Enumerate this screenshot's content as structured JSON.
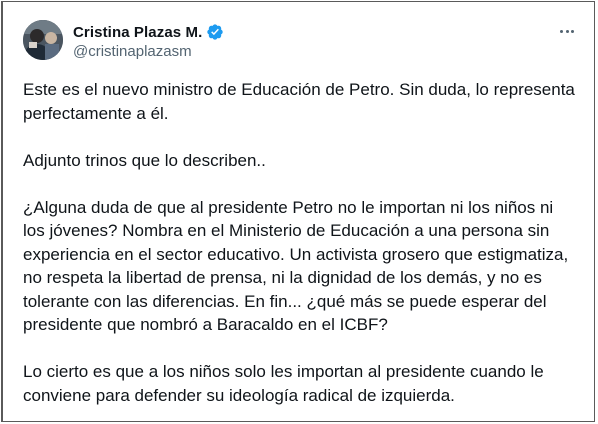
{
  "tweet": {
    "author": {
      "display_name": "Cristina Plazas M.",
      "handle": "@cristinaplazasm",
      "verified": true,
      "verified_color": "#1d9bf0"
    },
    "more_icon": "more-horizontal-icon",
    "paragraphs": [
      {
        "lines": [
          "Este es el nuevo ministro de Educación de Petro. Sin duda, lo representa",
          "perfectamente a él."
        ]
      },
      {
        "lines": [
          "Adjunto trinos que lo describen.."
        ]
      },
      {
        "lines": [
          "¿Alguna duda de que al presidente Petro no le importan ni los niños ni",
          "los jóvenes? Nombra en el Ministerio de Educación a una persona sin",
          "experiencia en el sector educativo. Un activista grosero que estigmatiza,",
          "no respeta la libertad de prensa, ni la dignidad de los demás, y no es",
          "tolerante con las diferencias. En fin... ¿qué más se puede esperar del",
          "presidente que nombró a Baracaldo en el ICBF?"
        ]
      },
      {
        "lines": [
          "Lo cierto es que a los niños solo les importan al presidente cuando le",
          "conviene para defender su ideología radical de izquierda."
        ]
      }
    ]
  }
}
